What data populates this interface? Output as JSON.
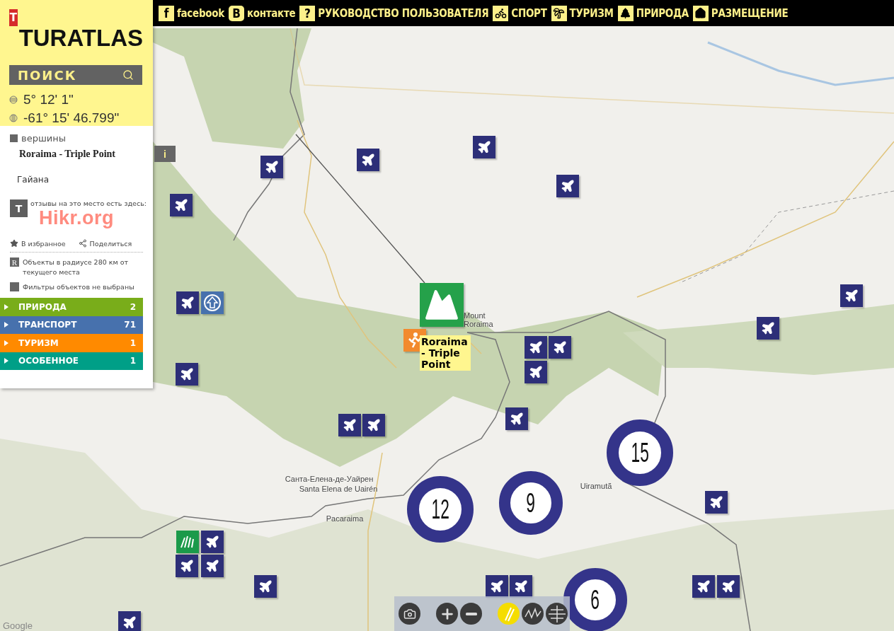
{
  "nav": [
    {
      "kind": "facebook",
      "glyph": "f",
      "label": "facebook"
    },
    {
      "kind": "vk",
      "glyph": "В",
      "label": "контакте"
    },
    {
      "kind": "manual",
      "glyph": "?",
      "label": "РУКОВОДСТВО ПОЛЬЗОВАТЕЛЯ"
    },
    {
      "kind": "sport",
      "label": "СПОРТ"
    },
    {
      "kind": "tourism",
      "label": "ТУРИЗМ"
    },
    {
      "kind": "nature",
      "label": "ПРИРОДА"
    },
    {
      "kind": "lodging",
      "label": "РАЗМЕЩЕНИЕ"
    }
  ],
  "header": {
    "logo_mark": "T",
    "logo": "TURATLAS",
    "search_label": "ПОИСК",
    "latitude": "5° 12' 1\"",
    "longitude": "-61° 15' 46.799\""
  },
  "place": {
    "category": "вершины",
    "name": "Roraima - Triple Point",
    "country": "Гайана",
    "info_button": "i"
  },
  "reviews": {
    "mark": "T",
    "text": "отзывы на это место есть здесь:",
    "site": "Hikr.org"
  },
  "actions": [
    {
      "kind": "favorite",
      "label": "В избранное"
    },
    {
      "kind": "share",
      "label": "Поделиться"
    }
  ],
  "radius": {
    "mark": "R",
    "text": "Объекты в радиусе 280 км от текущего места"
  },
  "filters": "Фильтры объектов не выбраны",
  "categories": [
    {
      "label": "ПРИРОДА",
      "count": "2",
      "color": "#79ad1a"
    },
    {
      "label": "ТРАНСПОРТ",
      "count": "71",
      "color": "#4771ad"
    },
    {
      "label": "ТУРИЗМ",
      "count": "1",
      "color": "#ff8a00"
    },
    {
      "label": "ОСОБЕННОЕ",
      "count": "1",
      "color": "#009f87"
    }
  ],
  "map": {
    "labels": [
      "Mount Roraima",
      "Санта-Елена-де-Уайрен",
      "Santa Elena de Uairén",
      "Pacaraima",
      "Uiramutã"
    ],
    "callout": "Roraima - Triple Point",
    "clusters": [
      {
        "count": "15"
      },
      {
        "count": "12"
      },
      {
        "count": "9"
      },
      {
        "count": "6"
      }
    ],
    "attribution": "Google"
  },
  "toolbar": [
    {
      "kind": "camera",
      "selected": false
    },
    {
      "kind": "zoom-in",
      "selected": false
    },
    {
      "kind": "zoom-out",
      "selected": false
    },
    {
      "kind": "satellite",
      "selected": true
    },
    {
      "kind": "terrain",
      "selected": false
    },
    {
      "kind": "globe",
      "selected": false
    }
  ]
}
